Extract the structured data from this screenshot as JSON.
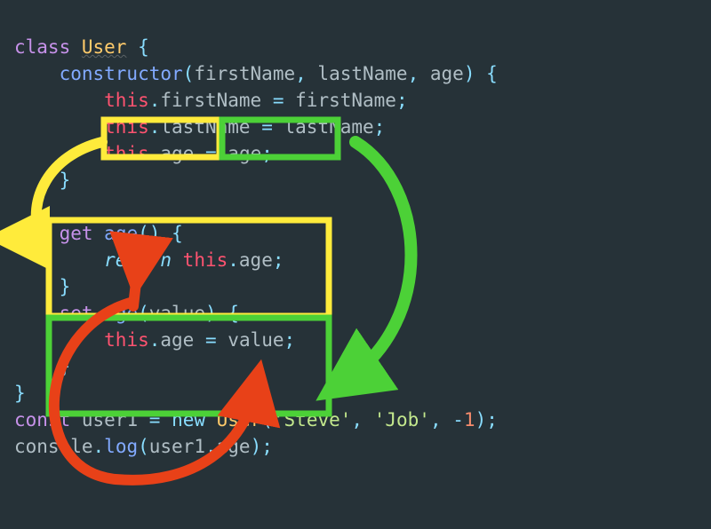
{
  "code": {
    "classKeyword": "class",
    "className": "User",
    "constructorKeyword": "constructor",
    "params": {
      "p1": "firstName",
      "p2": "lastName",
      "p3": "age"
    },
    "body": {
      "l1_this": "this",
      "l1_prop": "firstName",
      "l1_rhs": "firstName",
      "l2_this": "this",
      "l2_prop": "lastName",
      "l2_rhs": "lastName",
      "l3_this": "this",
      "l3_prop": "age",
      "l3_rhs": "age"
    },
    "getter": {
      "kw": "get",
      "name": "age",
      "ret": "return",
      "this": "this",
      "prop": "age"
    },
    "setter": {
      "kw": "set",
      "name": "age",
      "param": "value",
      "this": "this",
      "prop": "age",
      "rhs": "value"
    },
    "instantiate": {
      "const": "const",
      "varName": "user1",
      "new": "new",
      "className": "User",
      "arg1": "'Steve'",
      "arg2": "'Job'",
      "arg3": "-1"
    },
    "log": {
      "console": "console",
      "method": "log",
      "arg_obj": "user1",
      "arg_prop": "age"
    }
  }
}
